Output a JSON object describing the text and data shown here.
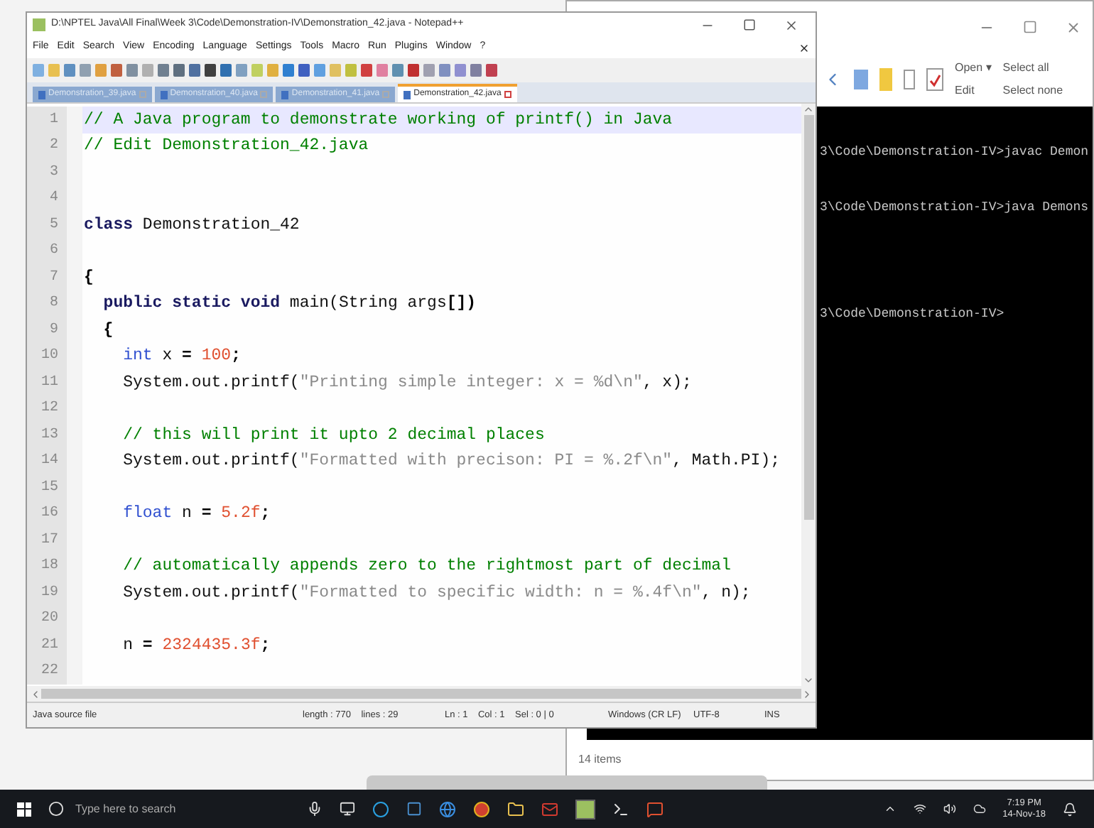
{
  "explorer": {
    "ribbon": {
      "open": "Open ▾",
      "edit": "Edit",
      "select_all": "Select all",
      "select_none": "Select none"
    },
    "console": [
      "3\\Code\\Demonstration-IV>javac Demon",
      "3\\Code\\Demonstration-IV>java Demons",
      "3\\Code\\Demonstration-IV>"
    ],
    "status": "14 items"
  },
  "notepad": {
    "title": "D:\\NPTEL Java\\All Final\\Week 3\\Code\\Demonstration-IV\\Demonstration_42.java - Notepad++",
    "menu": [
      "File",
      "Edit",
      "Search",
      "View",
      "Encoding",
      "Language",
      "Settings",
      "Tools",
      "Macro",
      "Run",
      "Plugins",
      "Window",
      "?"
    ],
    "tabs": [
      {
        "label": "Demonstration_39.java",
        "selected": false
      },
      {
        "label": "Demonstration_40.java",
        "selected": false
      },
      {
        "label": "Demonstration_41.java",
        "selected": false
      },
      {
        "label": "Demonstration_42.java",
        "selected": true
      }
    ],
    "lines": [
      {
        "number": "1",
        "current": true,
        "code": [
          {
            "kind": "comment",
            "t": "// A Java program to demonstrate working of printf() in Java"
          }
        ]
      },
      {
        "number": "2",
        "current": false,
        "code": [
          {
            "kind": "comment",
            "t": "// Edit Demonstration_42.java"
          }
        ]
      },
      {
        "number": "3",
        "current": false
      },
      {
        "number": "4",
        "current": false
      },
      {
        "number": "5",
        "current": false,
        "code": [
          {
            "kind": "keyword",
            "t": "class"
          },
          {
            "kind": "plain",
            "t": " Demonstration_42"
          }
        ]
      },
      {
        "number": "6",
        "current": false
      },
      {
        "number": "7",
        "current": false,
        "code": [
          {
            "kind": "op",
            "t": "{"
          }
        ]
      },
      {
        "number": "8",
        "current": false,
        "code": [
          {
            "kind": "keyword",
            "t": "  public static void"
          },
          {
            "kind": "plain",
            "t": " main(String args"
          },
          {
            "kind": "op",
            "t": "[])"
          }
        ]
      },
      {
        "number": "9",
        "current": false,
        "code": [
          {
            "kind": "op",
            "t": "  {"
          }
        ]
      },
      {
        "number": "10",
        "current": false,
        "code": [
          {
            "kind": "type",
            "t": "    int"
          },
          {
            "kind": "plain",
            "t": " x "
          },
          {
            "kind": "op",
            "t": "= "
          },
          {
            "kind": "number",
            "t": "100"
          },
          {
            "kind": "op",
            "t": ";"
          }
        ]
      },
      {
        "number": "11",
        "current": false,
        "code": [
          {
            "kind": "plain",
            "t": "    System.out.printf("
          },
          {
            "kind": "string",
            "t": "\"Printing simple integer: x = %d\\n\""
          },
          {
            "kind": "plain",
            "t": ", x);"
          }
        ]
      },
      {
        "number": "12",
        "current": false
      },
      {
        "number": "13",
        "current": false,
        "code": [
          {
            "kind": "comment",
            "t": "    // this will print it upto 2 decimal places"
          }
        ]
      },
      {
        "number": "14",
        "current": false,
        "code": [
          {
            "kind": "plain",
            "t": "    System.out.printf("
          },
          {
            "kind": "string",
            "t": "\"Formatted with precison: PI = %.2f\\n\""
          },
          {
            "kind": "plain",
            "t": ", Math.PI);"
          }
        ]
      },
      {
        "number": "15",
        "current": false
      },
      {
        "number": "16",
        "current": false,
        "code": [
          {
            "kind": "type",
            "t": "    float"
          },
          {
            "kind": "plain",
            "t": " n "
          },
          {
            "kind": "op",
            "t": "= "
          },
          {
            "kind": "number",
            "t": "5.2f"
          },
          {
            "kind": "op",
            "t": ";"
          }
        ]
      },
      {
        "number": "17",
        "current": false
      },
      {
        "number": "18",
        "current": false,
        "code": [
          {
            "kind": "comment",
            "t": "    // automatically appends zero to the rightmost part of decimal"
          }
        ]
      },
      {
        "number": "19",
        "current": false,
        "code": [
          {
            "kind": "plain",
            "t": "    System.out.printf("
          },
          {
            "kind": "string",
            "t": "\"Formatted to specific width: n = %.4f\\n\""
          },
          {
            "kind": "plain",
            "t": ", n);"
          }
        ]
      },
      {
        "number": "20",
        "current": false
      },
      {
        "number": "21",
        "current": false,
        "code": [
          {
            "kind": "plain",
            "t": "    n "
          },
          {
            "kind": "op",
            "t": "= "
          },
          {
            "kind": "number",
            "t": "2324435.3f"
          },
          {
            "kind": "op",
            "t": ";"
          }
        ]
      },
      {
        "number": "22",
        "current": false
      }
    ],
    "status": {
      "file_type": "Java source file",
      "length": "length : 770    lines : 29",
      "position": "Ln : 1    Col : 1    Sel : 0 | 0",
      "eol": "Windows (CR LF)",
      "encoding": "UTF-8",
      "mode": "INS"
    }
  },
  "taskbar": {
    "search": "Type here to search",
    "time": "7:19 PM",
    "date": "14-Nov-18"
  }
}
